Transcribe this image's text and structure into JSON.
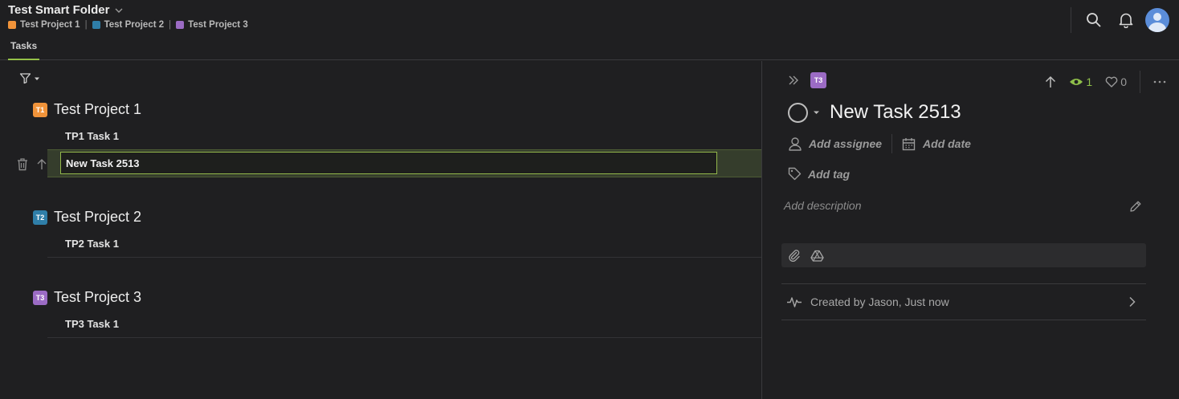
{
  "header": {
    "folder_title": "Test Smart Folder",
    "breadcrumbs": [
      {
        "label": "Test Project 1",
        "color": "#f0933a"
      },
      {
        "label": "Test Project 2",
        "color": "#2f7ea8"
      },
      {
        "label": "Test Project 3",
        "color": "#9b6bc4"
      }
    ],
    "crumb_separator": "|",
    "tab_label": "Tasks",
    "icons": [
      "search-icon",
      "bell-icon",
      "avatar"
    ]
  },
  "task_list": {
    "projects": [
      {
        "badge": "T1",
        "name": "Test Project 1",
        "color": "#f0933a",
        "tasks": [
          "TP1 Task 1"
        ]
      },
      {
        "badge": "T2",
        "name": "Test Project 2",
        "color": "#2f7ea8",
        "tasks": [
          "TP2 Task 1"
        ]
      },
      {
        "badge": "T3",
        "name": "Test Project 3",
        "color": "#9b6bc4",
        "tasks": [
          "TP3 Task 1"
        ]
      }
    ],
    "editing_task_value": "New Task 2513"
  },
  "detail": {
    "project_badge": "T3",
    "watchers_count": "1",
    "likes_count": "0",
    "title": "New Task 2513",
    "add_assignee": "Add assignee",
    "add_date": "Add date",
    "add_tag": "Add tag",
    "add_description": "Add description",
    "activity": "Created by Jason, Just now"
  },
  "colors": {
    "accent_green": "#95c148",
    "background": "#1f1f21"
  }
}
